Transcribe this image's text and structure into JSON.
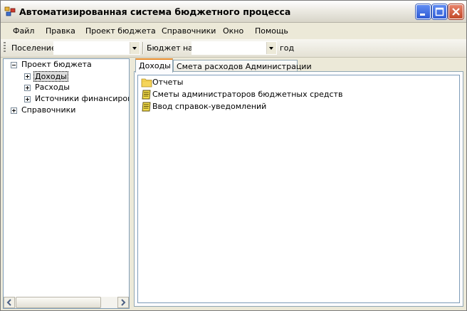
{
  "window": {
    "title": "Автоматизированная система бюджетного процесса"
  },
  "menu": {
    "items": [
      "Файл",
      "Правка",
      "Проект бюджета",
      "Справочники",
      "Окно",
      "Помощь"
    ]
  },
  "toolbar": {
    "settlement_label": "Поселение",
    "settlement_value": "",
    "budget_label": "Бюджет на",
    "year_value": "",
    "year_suffix": "год"
  },
  "tree": {
    "root": "Проект бюджета",
    "children": [
      "Доходы",
      "Расходы",
      "Источники финансирования"
    ],
    "second_root": "Справочники",
    "selected": "Доходы"
  },
  "tabs": [
    "Доходы",
    "Смета расходов Администрации"
  ],
  "active_tab": "Доходы",
  "list": [
    {
      "label": "Отчеты",
      "icon": "folder-icon"
    },
    {
      "label": "Сметы администраторов бюджетных средств",
      "icon": "form-icon"
    },
    {
      "label": "Ввод справок-уведомлений",
      "icon": "form-icon"
    }
  ]
}
